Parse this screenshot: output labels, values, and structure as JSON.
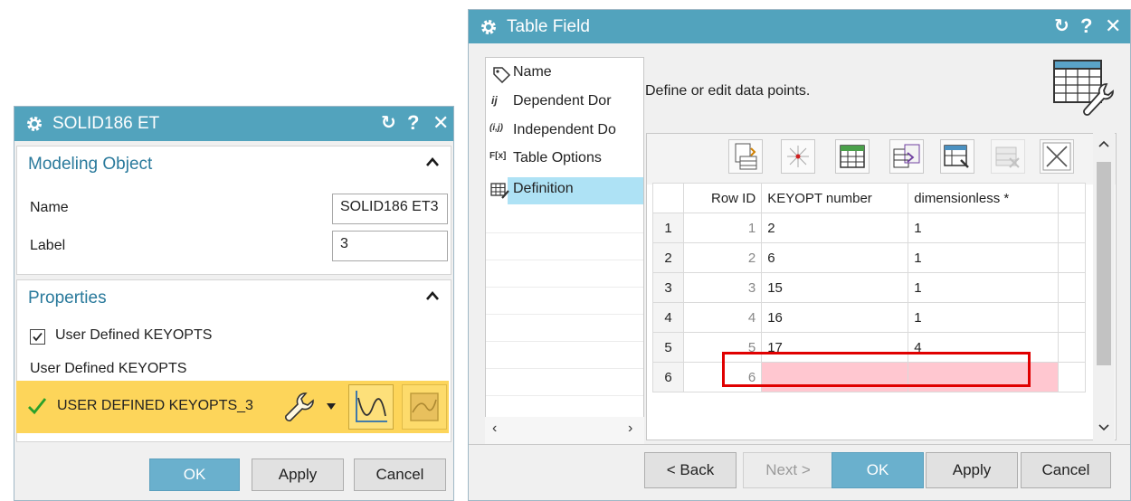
{
  "solid_dialog": {
    "title": "SOLID186 ET",
    "modeling_object_label": "Modeling Object",
    "name_label": "Name",
    "name_value": "SOLID186 ET3",
    "label_label": "Label",
    "label_value": "3",
    "properties_label": "Properties",
    "checkbox_label": "User Defined KEYOPTS",
    "checkbox_checked": true,
    "subheading": "User Defined KEYOPTS",
    "selected_table": "USER DEFINED KEYOPTS_3",
    "ok_label": "OK",
    "apply_label": "Apply",
    "cancel_label": "Cancel"
  },
  "table_dialog": {
    "title": "Table Field",
    "nav_items": [
      {
        "icon": "tag-icon",
        "label": "Name"
      },
      {
        "icon": "ij",
        "label": "Dependent Dor"
      },
      {
        "icon": "(i,j)",
        "label": "Independent Do"
      },
      {
        "icon": "F[x]",
        "label": "Table Options"
      },
      {
        "icon": "table-edit-icon",
        "label": "Definition"
      }
    ],
    "selected_nav": "Definition",
    "instruction": "Define or edit data points.",
    "columns": [
      "Row ID",
      "KEYOPT number",
      "dimensionless *"
    ],
    "rows": [
      {
        "row": "1",
        "id": "1",
        "keyopt": "2",
        "value": "1"
      },
      {
        "row": "2",
        "id": "2",
        "keyopt": "6",
        "value": "1"
      },
      {
        "row": "3",
        "id": "3",
        "keyopt": "15",
        "value": "1"
      },
      {
        "row": "4",
        "id": "4",
        "keyopt": "16",
        "value": "1"
      },
      {
        "row": "5",
        "id": "5",
        "keyopt": "17",
        "value": "4"
      },
      {
        "row": "6",
        "id": "6",
        "keyopt": "",
        "value": ""
      }
    ],
    "back_label": "< Back",
    "next_label": "Next >",
    "ok_label": "OK",
    "apply_label": "Apply",
    "cancel_label": "Cancel"
  },
  "colors": {
    "titlebar": "#52a3bd",
    "highlight_row": "#ffc7d0",
    "annotation_box": "#e00000",
    "yellow_selector": "#fdd55a"
  }
}
